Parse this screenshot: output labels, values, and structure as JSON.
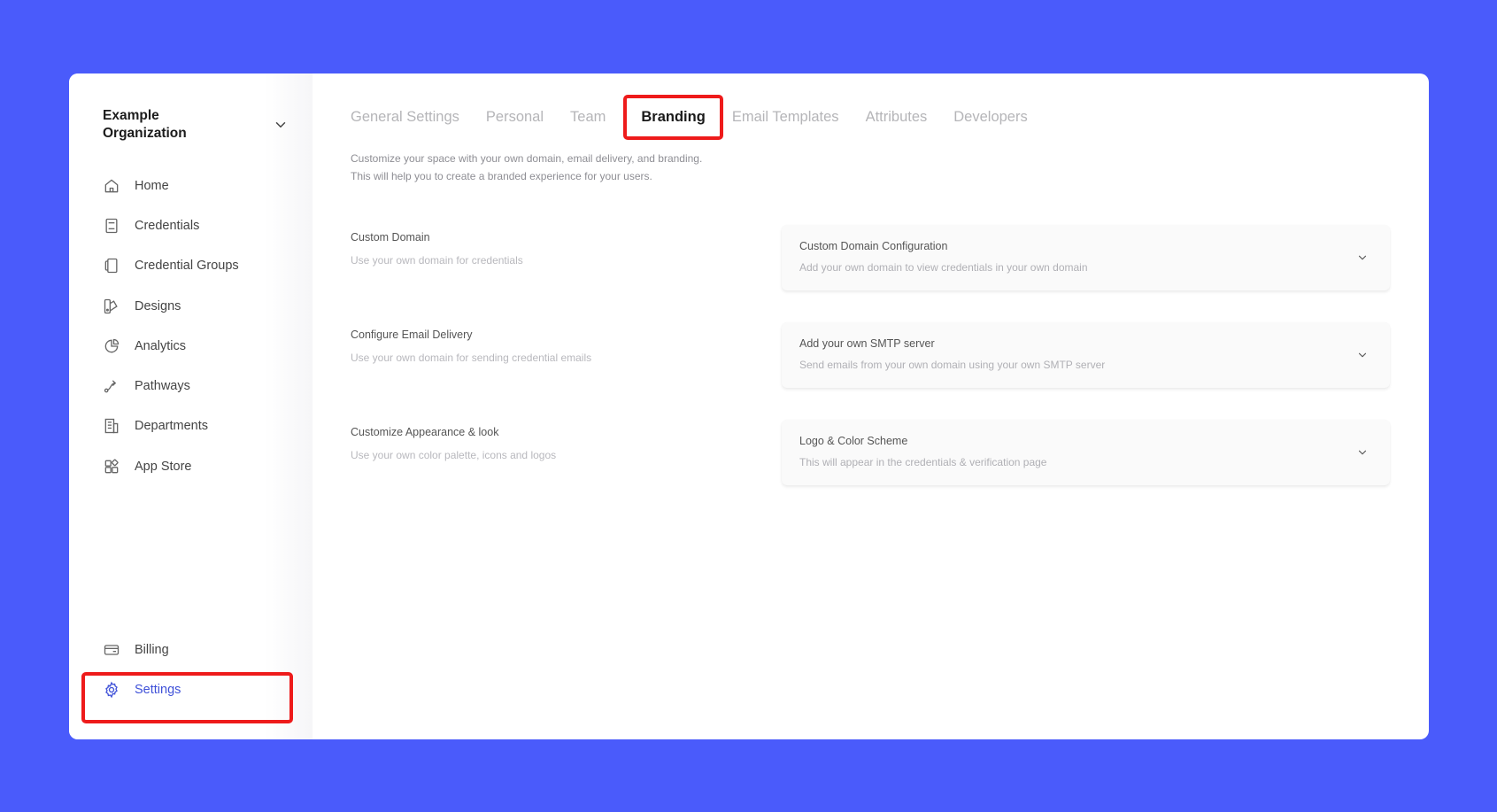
{
  "org": {
    "name": "Example Organization"
  },
  "sidebar": {
    "items": [
      {
        "label": "Home",
        "icon": "home-icon"
      },
      {
        "label": "Credentials",
        "icon": "credential-icon"
      },
      {
        "label": "Credential Groups",
        "icon": "credential-groups-icon"
      },
      {
        "label": "Designs",
        "icon": "designs-icon"
      },
      {
        "label": "Analytics",
        "icon": "analytics-icon"
      },
      {
        "label": "Pathways",
        "icon": "pathways-icon"
      },
      {
        "label": "Departments",
        "icon": "departments-icon"
      },
      {
        "label": "App Store",
        "icon": "app-store-icon"
      }
    ],
    "billing": {
      "label": "Billing",
      "icon": "card-icon"
    },
    "settings": {
      "label": "Settings",
      "icon": "gear-icon"
    }
  },
  "tabs": [
    {
      "label": "General Settings"
    },
    {
      "label": "Personal"
    },
    {
      "label": "Team"
    },
    {
      "label": "Branding",
      "active": true
    },
    {
      "label": "Email Templates"
    },
    {
      "label": "Attributes"
    },
    {
      "label": "Developers"
    }
  ],
  "intro": {
    "line1": "Customize your space with your own domain, email delivery, and branding.",
    "line2": "This will help you to create a branded experience for your users."
  },
  "sections": [
    {
      "title": "Custom Domain",
      "desc": "Use your own domain for credentials",
      "card_title": "Custom Domain Configuration",
      "card_desc": "Add your own domain to view credentials in your own domain"
    },
    {
      "title": "Configure Email Delivery",
      "desc": "Use your own domain for sending credential emails",
      "card_title": "Add your own SMTP server",
      "card_desc": "Send emails from your own domain using your own SMTP server"
    },
    {
      "title": "Customize Appearance & look",
      "desc": "Use your own color palette, icons and logos",
      "card_title": "Logo & Color Scheme",
      "card_desc": "This will appear in the credentials & verification page"
    }
  ],
  "colors": {
    "background": "#4a5bfb",
    "accent": "#3f51d8",
    "highlight": "#ee1b1b"
  }
}
